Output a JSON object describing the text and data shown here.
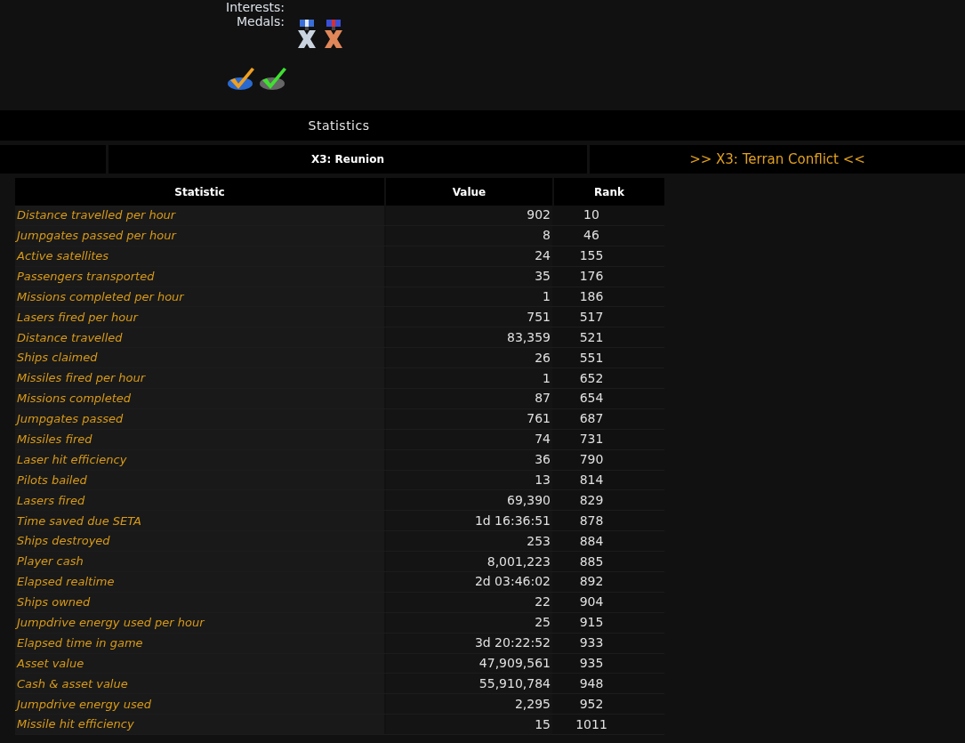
{
  "profile": {
    "fields": [
      {
        "label": "Interests:"
      },
      {
        "label": "Medals:",
        "medals": [
          {
            "kind": "silver"
          },
          {
            "kind": "bronze"
          }
        ]
      }
    ],
    "badges": [
      {
        "kind": "orange"
      },
      {
        "kind": "green"
      }
    ]
  },
  "section": {
    "title": "Statistics"
  },
  "tabs": [
    {
      "label": "X3: Reunion",
      "selected": true
    },
    {
      "label": ">> X3: Terran Conflict <<",
      "selected": false
    }
  ],
  "table": {
    "columns": [
      "Statistic",
      "Value",
      "Rank"
    ],
    "rows": [
      [
        "Distance travelled per hour",
        "902",
        "10"
      ],
      [
        "Jumpgates passed per hour",
        "8",
        "46"
      ],
      [
        "Active satellites",
        "24",
        "155"
      ],
      [
        "Passengers transported",
        "35",
        "176"
      ],
      [
        "Missions completed per hour",
        "1",
        "186"
      ],
      [
        "Lasers fired per hour",
        "751",
        "517"
      ],
      [
        "Distance travelled",
        "83,359",
        "521"
      ],
      [
        "Ships claimed",
        "26",
        "551"
      ],
      [
        "Missiles fired per hour",
        "1",
        "652"
      ],
      [
        "Missions completed",
        "87",
        "654"
      ],
      [
        "Jumpgates passed",
        "761",
        "687"
      ],
      [
        "Missiles fired",
        "74",
        "731"
      ],
      [
        "Laser hit efficiency",
        "36",
        "790"
      ],
      [
        "Pilots bailed",
        "13",
        "814"
      ],
      [
        "Lasers fired",
        "69,390",
        "829"
      ],
      [
        "Time saved due SETA",
        "1d 16:36:51",
        "878"
      ],
      [
        "Ships destroyed",
        "253",
        "884"
      ],
      [
        "Player cash",
        "8,001,223",
        "885"
      ],
      [
        "Elapsed realtime",
        "2d 03:46:02",
        "892"
      ],
      [
        "Ships owned",
        "22",
        "904"
      ],
      [
        "Jumpdrive energy used per hour",
        "25",
        "915"
      ],
      [
        "Elapsed time in game",
        "3d 20:22:52",
        "933"
      ],
      [
        "Asset value",
        "47,909,561",
        "935"
      ],
      [
        "Cash & asset value",
        "55,910,784",
        "948"
      ],
      [
        "Jumpdrive energy used",
        "2,295",
        "952"
      ],
      [
        "Missile hit efficiency",
        "15",
        "1011"
      ]
    ]
  }
}
